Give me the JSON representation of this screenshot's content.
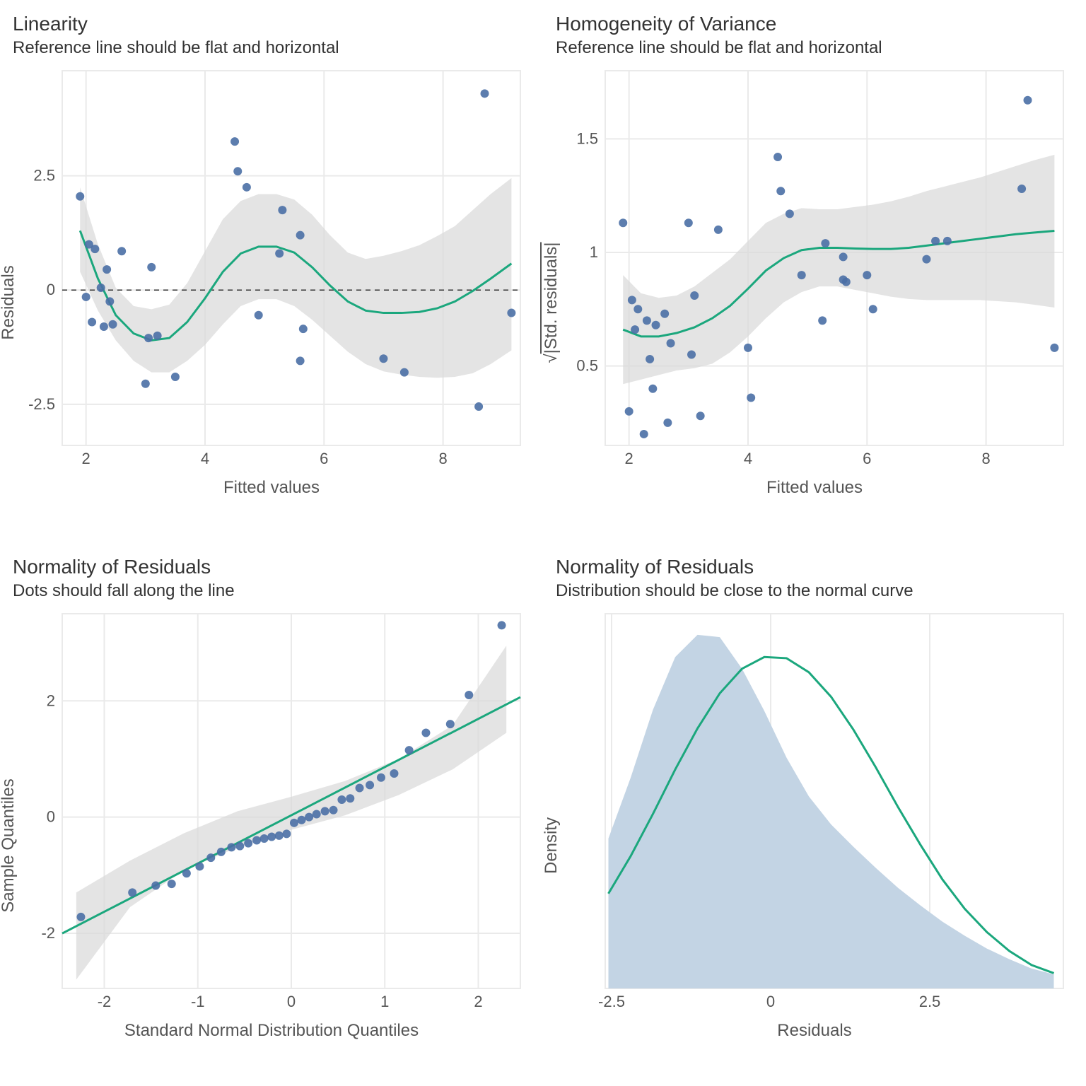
{
  "panels": {
    "tl": {
      "title": "Linearity",
      "subtitle": "Reference line should be flat and horizontal",
      "xlabel": "Fitted values",
      "ylabel": "Residuals"
    },
    "tr": {
      "title": "Homogeneity of Variance",
      "subtitle": "Reference line should be flat and horizontal",
      "xlabel": "Fitted values",
      "ylabel": "√|Std. residuals|"
    },
    "bl": {
      "title": "Normality of Residuals",
      "subtitle": "Dots should fall along the line",
      "xlabel": "Standard Normal Distribution Quantiles",
      "ylabel": "Sample Quantiles"
    },
    "br": {
      "title": "Normality of Residuals",
      "subtitle": "Distribution should be close to the normal curve",
      "xlabel": "Residuals",
      "ylabel": "Density"
    }
  },
  "axes": {
    "tl": {
      "x_ticks": [
        2,
        4,
        6,
        8
      ],
      "y_ticks": [
        -2.5,
        0.0,
        2.5
      ],
      "x_range": [
        1.6,
        9.3
      ],
      "y_range": [
        -3.4,
        4.8
      ]
    },
    "tr": {
      "x_ticks": [
        2,
        4,
        6,
        8
      ],
      "y_ticks": [
        0.5,
        1.0,
        1.5
      ],
      "x_range": [
        1.6,
        9.3
      ],
      "y_range": [
        0.15,
        1.8
      ]
    },
    "bl": {
      "x_ticks": [
        -2,
        -1,
        0,
        1,
        2
      ],
      "y_ticks": [
        -2,
        0,
        2
      ],
      "x_range": [
        -2.45,
        2.45
      ],
      "y_range": [
        -2.95,
        3.5
      ]
    },
    "br": {
      "x_ticks": [
        -2.5,
        0.0,
        2.5
      ],
      "x_range": [
        -2.6,
        4.6
      ],
      "y_range": [
        0,
        0.32
      ]
    }
  },
  "chart_data": [
    {
      "id": "linearity",
      "type": "scatter",
      "title": "Linearity",
      "xlabel": "Fitted values",
      "ylabel": "Residuals",
      "x_ticks": [
        2,
        4,
        6,
        8
      ],
      "y_ticks": [
        -2.5,
        0.0,
        2.5
      ],
      "xlim": [
        1.6,
        9.3
      ],
      "ylim": [
        -3.4,
        4.8
      ],
      "hline": 0,
      "points": [
        [
          1.9,
          2.05
        ],
        [
          2.0,
          -0.15
        ],
        [
          2.05,
          1.0
        ],
        [
          2.1,
          -0.7
        ],
        [
          2.15,
          0.9
        ],
        [
          2.25,
          0.05
        ],
        [
          2.3,
          -0.8
        ],
        [
          2.35,
          0.45
        ],
        [
          2.4,
          -0.25
        ],
        [
          2.45,
          -0.75
        ],
        [
          2.6,
          0.85
        ],
        [
          3.0,
          -2.05
        ],
        [
          3.05,
          -1.05
        ],
        [
          3.1,
          0.5
        ],
        [
          3.2,
          -1.0
        ],
        [
          3.5,
          -1.9
        ],
        [
          4.5,
          3.25
        ],
        [
          4.55,
          2.6
        ],
        [
          4.7,
          2.25
        ],
        [
          4.9,
          -0.55
        ],
        [
          5.25,
          0.8
        ],
        [
          5.3,
          1.75
        ],
        [
          5.6,
          -1.55
        ],
        [
          5.6,
          1.2
        ],
        [
          5.65,
          -0.85
        ],
        [
          7.0,
          -1.5
        ],
        [
          7.35,
          -1.8
        ],
        [
          8.6,
          -2.55
        ],
        [
          8.7,
          4.3
        ],
        [
          9.15,
          -0.5
        ]
      ],
      "smooth_x": [
        1.9,
        2.2,
        2.5,
        2.8,
        3.1,
        3.4,
        3.7,
        4.0,
        4.3,
        4.6,
        4.9,
        5.2,
        5.5,
        5.8,
        6.1,
        6.4,
        6.7,
        7.0,
        7.3,
        7.6,
        7.9,
        8.2,
        8.5,
        8.8,
        9.15
      ],
      "smooth_y": [
        1.3,
        0.25,
        -0.55,
        -0.95,
        -1.1,
        -1.05,
        -0.7,
        -0.18,
        0.4,
        0.8,
        0.95,
        0.95,
        0.82,
        0.5,
        0.1,
        -0.25,
        -0.45,
        -0.5,
        -0.5,
        -0.48,
        -0.4,
        -0.25,
        -0.02,
        0.25,
        0.58
      ],
      "band_lo": [
        0.4,
        -0.45,
        -1.1,
        -1.55,
        -1.8,
        -1.8,
        -1.55,
        -1.2,
        -0.75,
        -0.35,
        -0.2,
        -0.2,
        -0.35,
        -0.65,
        -1.0,
        -1.35,
        -1.62,
        -1.78,
        -1.85,
        -1.9,
        -1.92,
        -1.9,
        -1.82,
        -1.62,
        -1.32
      ],
      "band_hi": [
        2.25,
        1.0,
        0.05,
        -0.35,
        -0.42,
        -0.32,
        0.15,
        0.85,
        1.55,
        1.95,
        2.1,
        2.1,
        1.98,
        1.65,
        1.2,
        0.82,
        0.68,
        0.75,
        0.85,
        0.98,
        1.18,
        1.4,
        1.75,
        2.1,
        2.45
      ]
    },
    {
      "id": "scale-location",
      "type": "scatter",
      "title": "Homogeneity of Variance",
      "xlabel": "Fitted values",
      "ylabel": "sqrt(|Std. residuals|)",
      "x_ticks": [
        2,
        4,
        6,
        8
      ],
      "y_ticks": [
        0.5,
        1.0,
        1.5
      ],
      "xlim": [
        1.6,
        9.3
      ],
      "ylim": [
        0.15,
        1.8
      ],
      "points": [
        [
          1.9,
          1.13
        ],
        [
          2.0,
          0.3
        ],
        [
          2.05,
          0.79
        ],
        [
          2.1,
          0.66
        ],
        [
          2.15,
          0.75
        ],
        [
          2.25,
          0.2
        ],
        [
          2.3,
          0.7
        ],
        [
          2.35,
          0.53
        ],
        [
          2.4,
          0.4
        ],
        [
          2.45,
          0.68
        ],
        [
          2.6,
          0.73
        ],
        [
          2.65,
          0.25
        ],
        [
          2.7,
          0.6
        ],
        [
          3.0,
          1.13
        ],
        [
          3.05,
          0.55
        ],
        [
          3.1,
          0.81
        ],
        [
          3.2,
          0.28
        ],
        [
          3.5,
          1.1
        ],
        [
          4.0,
          0.58
        ],
        [
          4.05,
          0.36
        ],
        [
          4.5,
          1.42
        ],
        [
          4.55,
          1.27
        ],
        [
          4.7,
          1.17
        ],
        [
          4.9,
          0.9
        ],
        [
          5.25,
          0.7
        ],
        [
          5.3,
          1.04
        ],
        [
          5.6,
          0.98
        ],
        [
          5.6,
          0.88
        ],
        [
          5.65,
          0.87
        ],
        [
          6.0,
          0.9
        ],
        [
          6.1,
          0.75
        ],
        [
          7.0,
          0.97
        ],
        [
          7.15,
          1.05
        ],
        [
          7.35,
          1.05
        ],
        [
          8.6,
          1.28
        ],
        [
          8.7,
          1.67
        ],
        [
          9.15,
          0.58
        ]
      ],
      "smooth_x": [
        1.9,
        2.2,
        2.5,
        2.8,
        3.1,
        3.4,
        3.7,
        4.0,
        4.3,
        4.6,
        4.9,
        5.2,
        5.5,
        5.8,
        6.1,
        6.4,
        6.7,
        7.0,
        7.3,
        7.6,
        7.9,
        8.2,
        8.5,
        8.8,
        9.15
      ],
      "smooth_y": [
        0.66,
        0.63,
        0.63,
        0.645,
        0.67,
        0.71,
        0.765,
        0.84,
        0.92,
        0.975,
        1.01,
        1.02,
        1.02,
        1.017,
        1.015,
        1.015,
        1.02,
        1.03,
        1.04,
        1.05,
        1.06,
        1.07,
        1.08,
        1.087,
        1.095
      ],
      "band_lo": [
        0.42,
        0.44,
        0.46,
        0.48,
        0.49,
        0.51,
        0.56,
        0.63,
        0.71,
        0.78,
        0.825,
        0.85,
        0.85,
        0.835,
        0.82,
        0.805,
        0.795,
        0.79,
        0.79,
        0.79,
        0.79,
        0.785,
        0.78,
        0.77,
        0.757
      ],
      "band_hi": [
        0.9,
        0.82,
        0.8,
        0.81,
        0.85,
        0.91,
        0.97,
        1.05,
        1.13,
        1.17,
        1.195,
        1.19,
        1.19,
        1.2,
        1.21,
        1.225,
        1.245,
        1.27,
        1.29,
        1.31,
        1.33,
        1.355,
        1.38,
        1.405,
        1.43
      ]
    },
    {
      "id": "qq",
      "type": "scatter",
      "title": "Normality of Residuals (QQ)",
      "xlabel": "Standard Normal Distribution Quantiles",
      "ylabel": "Sample Quantiles",
      "x_ticks": [
        -2,
        -1,
        0,
        1,
        2
      ],
      "y_ticks": [
        -2,
        0,
        2
      ],
      "xlim": [
        -2.45,
        2.45
      ],
      "ylim": [
        -2.95,
        3.5
      ],
      "ref_line": {
        "slope": 0.83,
        "intercept": 0.03
      },
      "points": [
        [
          -2.25,
          -1.72
        ],
        [
          -1.7,
          -1.3
        ],
        [
          -1.45,
          -1.18
        ],
        [
          -1.28,
          -1.15
        ],
        [
          -1.12,
          -0.97
        ],
        [
          -0.98,
          -0.85
        ],
        [
          -0.86,
          -0.7
        ],
        [
          -0.75,
          -0.6
        ],
        [
          -0.64,
          -0.52
        ],
        [
          -0.55,
          -0.5
        ],
        [
          -0.46,
          -0.45
        ],
        [
          -0.37,
          -0.4
        ],
        [
          -0.29,
          -0.37
        ],
        [
          -0.21,
          -0.34
        ],
        [
          -0.13,
          -0.32
        ],
        [
          -0.05,
          -0.29
        ],
        [
          0.03,
          -0.1
        ],
        [
          0.11,
          -0.05
        ],
        [
          0.19,
          0.0
        ],
        [
          0.27,
          0.05
        ],
        [
          0.36,
          0.1
        ],
        [
          0.45,
          0.12
        ],
        [
          0.54,
          0.3
        ],
        [
          0.63,
          0.32
        ],
        [
          0.73,
          0.5
        ],
        [
          0.84,
          0.55
        ],
        [
          0.96,
          0.68
        ],
        [
          1.1,
          0.75
        ],
        [
          1.26,
          1.15
        ],
        [
          1.44,
          1.45
        ],
        [
          1.7,
          1.6
        ],
        [
          1.9,
          2.1
        ],
        [
          2.25,
          3.3
        ]
      ],
      "band_lo_y": [
        -2.8,
        -1.55,
        -0.92,
        -0.52,
        -0.22,
        0.03,
        0.38,
        0.82,
        1.45
      ],
      "band_hi_y": [
        -1.3,
        -0.75,
        -0.28,
        0.1,
        0.35,
        0.62,
        1.0,
        1.58,
        2.95
      ],
      "band_x": [
        -2.3,
        -1.725,
        -1.15,
        -0.575,
        0.0,
        0.575,
        1.15,
        1.725,
        2.3
      ]
    },
    {
      "id": "density",
      "type": "area",
      "title": "Normality of Residuals (density)",
      "xlabel": "Residuals",
      "ylabel": "Density",
      "x_ticks": [
        -2.5,
        0.0,
        2.5
      ],
      "xlim": [
        -2.6,
        4.6
      ],
      "ylim": [
        0,
        0.32
      ],
      "kde_x": [
        -2.55,
        -2.2,
        -1.85,
        -1.5,
        -1.15,
        -0.8,
        -0.45,
        -0.1,
        0.25,
        0.6,
        0.95,
        1.3,
        1.65,
        2.0,
        2.35,
        2.7,
        3.05,
        3.4,
        3.75,
        4.1,
        4.45
      ],
      "kde_y": [
        0.128,
        0.18,
        0.238,
        0.283,
        0.302,
        0.3,
        0.273,
        0.237,
        0.197,
        0.164,
        0.14,
        0.121,
        0.103,
        0.086,
        0.071,
        0.057,
        0.045,
        0.034,
        0.025,
        0.017,
        0.012
      ],
      "normal_x": [
        -2.55,
        -2.2,
        -1.85,
        -1.5,
        -1.15,
        -0.8,
        -0.45,
        -0.1,
        0.25,
        0.6,
        0.95,
        1.3,
        1.65,
        2.0,
        2.35,
        2.7,
        3.05,
        3.4,
        3.75,
        4.1,
        4.45
      ],
      "normal_y": [
        0.081,
        0.113,
        0.149,
        0.187,
        0.222,
        0.252,
        0.273,
        0.283,
        0.282,
        0.27,
        0.249,
        0.221,
        0.189,
        0.155,
        0.123,
        0.093,
        0.068,
        0.048,
        0.032,
        0.02,
        0.013
      ]
    }
  ]
}
